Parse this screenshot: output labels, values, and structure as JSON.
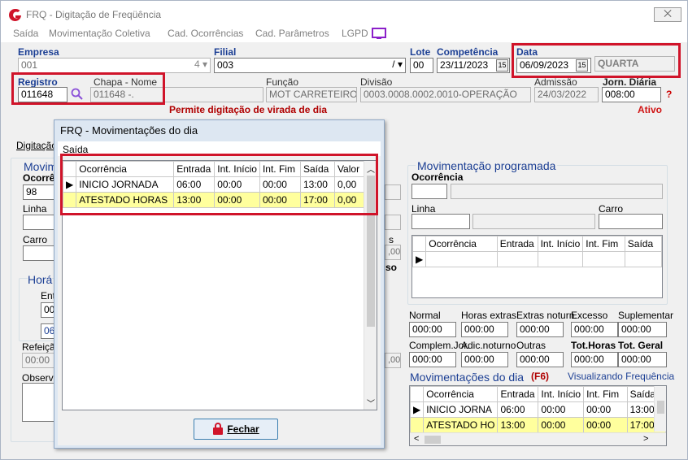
{
  "window": {
    "title": "FRQ - Digitação de Freqüência",
    "close": "⨉"
  },
  "menu": {
    "items": [
      "Saída",
      "Movimentação Coletiva",
      "Cad. Ocorrências",
      "Cad. Parâmetros",
      "LGPD"
    ]
  },
  "header": {
    "empresa_label": "Empresa",
    "empresa_value": "001",
    "filial_label": "Filial",
    "filial_value": "003",
    "lote_label": "Lote",
    "lote_value": "00",
    "competencia_label": "Competência",
    "competencia_value": "23/11/2023",
    "data_label": "Data",
    "data_value": "06/09/2023",
    "weekday": "QUARTA",
    "registro_label": "Registro",
    "registro_value": "011648",
    "chapa_label": "Chapa  -  Nome",
    "chapa_value": "011648 -.",
    "funcao_label": "Função",
    "funcao_value": "MOT CARRETEIRO",
    "divisao_label": "Divisão",
    "divisao_value": "0003.0008.0002.0010-OPERAÇÃO",
    "admissao_label": "Admissão",
    "admissao_value": "24/03/2022",
    "jorn_label": "Jorn. Diária",
    "jorn_value": "008:00",
    "help": "?",
    "warning": "Permite digitação de virada de dia",
    "status": "Ativo"
  },
  "left": {
    "tab": "Digitação",
    "grp_mov": "Movim",
    "ocorr": "Ocorrê",
    "ocorr_val": "98",
    "linha": "Linha",
    "carro": "Carro",
    "grp_hor": "Horá",
    "ent": "Ent",
    "ent_val": "00:",
    "v06": "06",
    "refeicao": "Refeiçã",
    "ref_val": "00:00",
    "observ": "Observa"
  },
  "mid": {
    "s": "s",
    "v00": ",00",
    "so": "so",
    "v00b": ",00"
  },
  "right": {
    "grp_title": "Movimentação programada",
    "ocorrencia": "Ocorrência",
    "linha": "Linha",
    "carro": "Carro",
    "prog_cols": [
      "Ocorrência",
      "Entrada",
      "Int. Início",
      "Int. Fim",
      "Saída"
    ],
    "totals_row1": [
      {
        "label": "Normal",
        "value": "000:00"
      },
      {
        "label": "Horas extras",
        "value": "000:00"
      },
      {
        "label": "Extras noturn.",
        "value": "000:00"
      },
      {
        "label": "Excesso",
        "value": "000:00"
      },
      {
        "label": "Suplementar",
        "value": "000:00"
      }
    ],
    "totals_row2": [
      {
        "label": "Complem.Jor.",
        "value": "000:00"
      },
      {
        "label": "Adic.noturno",
        "value": "000:00"
      },
      {
        "label": "Outras",
        "value": "000:00"
      },
      {
        "label": "Tot.Horas",
        "value": "000:00"
      },
      {
        "label": "Tot. Geral",
        "value": "000:00"
      }
    ],
    "movdia_title": "Movimentações do dia",
    "f6": "(F6)",
    "visual": "Visualizando Frequência",
    "mov_cols": [
      "Ocorrência",
      "Entrada",
      "Int. Início",
      "Int. Fim",
      "Saída"
    ],
    "mov_rows": [
      [
        "INICIO JORNA",
        "06:00",
        "00:00",
        "00:00",
        "13:00"
      ],
      [
        "ATESTADO HO",
        "13:00",
        "00:00",
        "00:00",
        "17:00"
      ]
    ]
  },
  "modal": {
    "title": "FRQ - Movimentações do dia",
    "menu": "Saída",
    "cols": [
      "Ocorrência",
      "Entrada",
      "Int. Início",
      "Int. Fim",
      "Saída",
      "Valor"
    ],
    "rows": [
      [
        "INICIO JORNADA",
        "06:00",
        "00:00",
        "00:00",
        "13:00",
        "0,00"
      ],
      [
        "ATESTADO HORAS",
        "13:00",
        "00:00",
        "00:00",
        "17:00",
        "0,00"
      ]
    ],
    "close_button": "Fechar"
  },
  "colors": {
    "highlight": "#ffff9d",
    "red_box": "#d0142a",
    "label_blue": "#1c3f94",
    "warning_red": "#b00000"
  }
}
